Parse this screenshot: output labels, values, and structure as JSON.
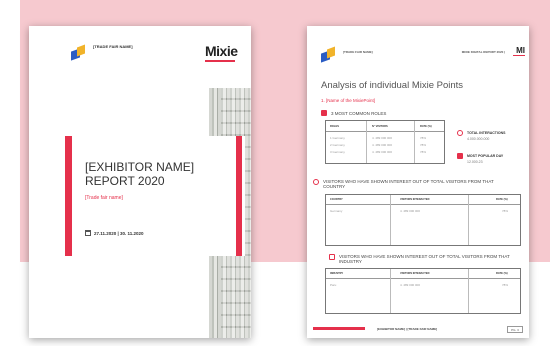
{
  "cover": {
    "trade_fair_label": "[TRADE FAIR NAME]",
    "brand": "Mixie",
    "exhibitor_report": "[EXHIBITOR NAME] REPORT 2020",
    "trade_fair_name": "[Trade fair name]",
    "dates": "27.11.2020 | 30. 11.2020"
  },
  "report": {
    "trade_fair_label": "[TRADE FAIR NAME]",
    "header_right": "MIXIE DIGITAL REPORT 2020 |",
    "brand": "MI",
    "title": "Analysis of individual Mixie Points",
    "subtitle": "1. [Name of the MixiePoint]",
    "roles_heading": "3 MOST COMMON ROLES",
    "roles_table": {
      "headers": [
        "ROLES",
        "N° VISITORS",
        "RATE (%)"
      ],
      "rows": [
        [
          "1 Germany",
          "4. 489 000 000",
          "78%"
        ],
        [
          "2 Germany",
          "4. 489 000 000",
          "78%"
        ],
        [
          "3 Germany",
          "4. 489 000 000",
          "78%"
        ]
      ]
    },
    "total_interactions_label": "TOTAL INTERACTIONS",
    "total_interactions_value": "4.000.000.000",
    "popular_day_label": "MOST POPULAR DAY",
    "popular_day_value": "12.000.23",
    "country_heading": "VISITORS WHO HAVE SHOWN INTEREST OUT OF TOTAL VISITORS FROM THAT COUNTRY",
    "country_table": {
      "headers": [
        "COUNTRY",
        "VISITORS INTERACTED",
        "RATE (%)"
      ],
      "row": [
        "Germany",
        "4. 489 000 000",
        "78%"
      ]
    },
    "industry_heading": "VISITORS WHO HAVE SHOWN  INTEREST OUT OF TOTAL VISITORS FROM THAT INDUSTRY",
    "industry_table": {
      "headers": [
        "INDUSTRY",
        "VISITORS INTERACTED",
        "RATE (%)"
      ],
      "row": [
        "Paru",
        "4. 489 000 000",
        "78%"
      ]
    },
    "footer": "[EXHIBITOR NAME] | [TRADE FAIR NAME]",
    "page_label": "PG. 3"
  },
  "colors": {
    "accent": "#e5304b",
    "background_band": "#f6c9cf",
    "logo_blue": "#2a5cc4",
    "logo_yellow": "#f1b32a"
  }
}
